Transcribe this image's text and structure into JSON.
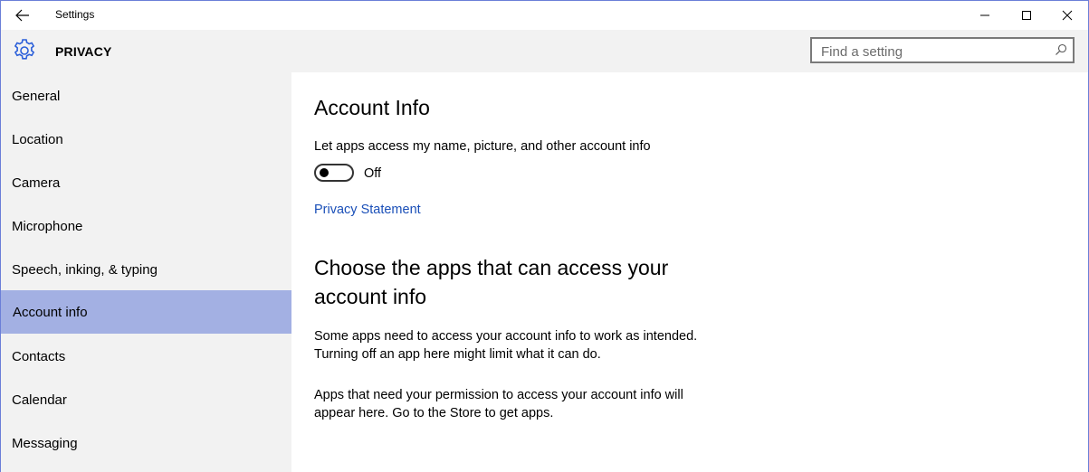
{
  "window": {
    "app_title": "Settings",
    "minimize_icon": "minimize-icon",
    "maximize_icon": "maximize-icon",
    "close_icon": "close-icon"
  },
  "header": {
    "section_title": "PRIVACY",
    "icon": "gear-icon",
    "accent_color": "#2b5fd9"
  },
  "search": {
    "placeholder": "Find a setting",
    "value": ""
  },
  "sidebar": {
    "items": [
      {
        "label": "General",
        "active": false
      },
      {
        "label": "Location",
        "active": false
      },
      {
        "label": "Camera",
        "active": false
      },
      {
        "label": "Microphone",
        "active": false
      },
      {
        "label": "Speech, inking, & typing",
        "active": false
      },
      {
        "label": "Account info",
        "active": true
      },
      {
        "label": "Contacts",
        "active": false
      },
      {
        "label": "Calendar",
        "active": false
      },
      {
        "label": "Messaging",
        "active": false
      }
    ],
    "active_color": "#a3b0e3"
  },
  "main": {
    "heading": "Account Info",
    "toggle_label": "Let apps access my name, picture, and other account info",
    "toggle_state": "Off",
    "privacy_link": "Privacy Statement",
    "apps_heading": "Choose the apps that can access your account info",
    "paragraph1_line1": "Some apps need to access your account info to work as intended.",
    "paragraph1_line2": "Turning off an app here might limit what it can do.",
    "paragraph2_line1": "Apps that need your permission to access your account info will",
    "paragraph2_line2": "appear here. Go to the Store to get apps.",
    "link_color": "#1a4fb8"
  }
}
